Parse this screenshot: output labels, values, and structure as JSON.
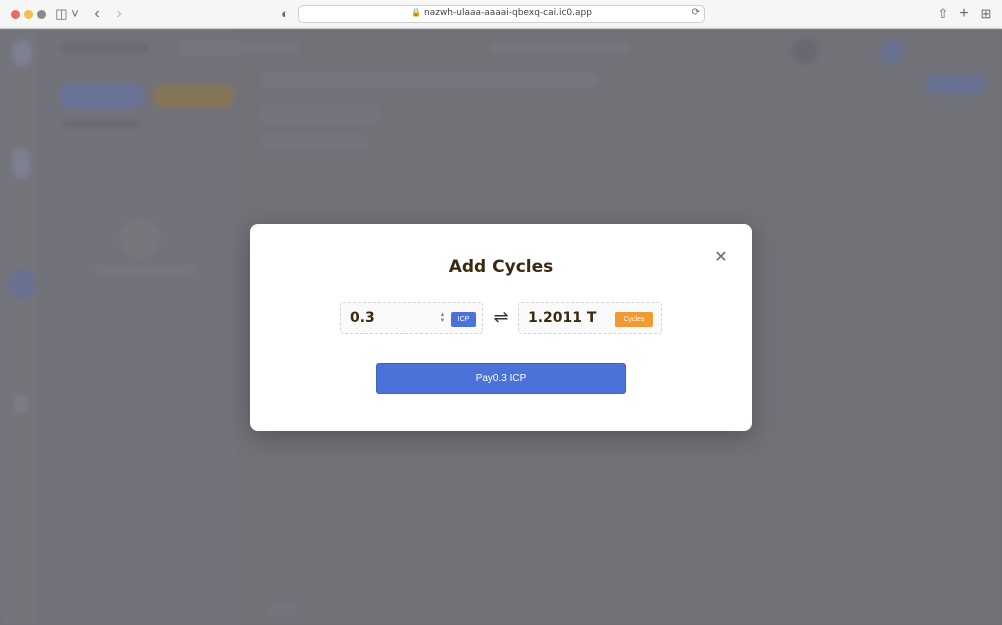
{
  "browser": {
    "url": "nazwh-ulaaa-aaaai-qbexq-cai.ic0.app",
    "icons": {
      "sidebar": "sidebar-icon",
      "back": "chevron-left-icon",
      "forward": "chevron-right-icon",
      "privacy": "shield-icon",
      "share": "share-icon",
      "new_tab": "plus-icon",
      "tabs": "tab-overview-icon"
    }
  },
  "modal": {
    "title": "Add Cycles",
    "close_icon": "close-icon",
    "icp_input": {
      "value": "0.3",
      "unit_tag": "ICP"
    },
    "swap_icon": "swap-arrows-icon",
    "cycles_output": {
      "value": "1.2011 T",
      "unit_tag": "Cycles"
    },
    "pay_button_label": "Pay0.3 ICP"
  },
  "colors": {
    "primary": "#4a72d9",
    "cycles_tag": "#f09a32",
    "title_text": "#3a2a10"
  }
}
